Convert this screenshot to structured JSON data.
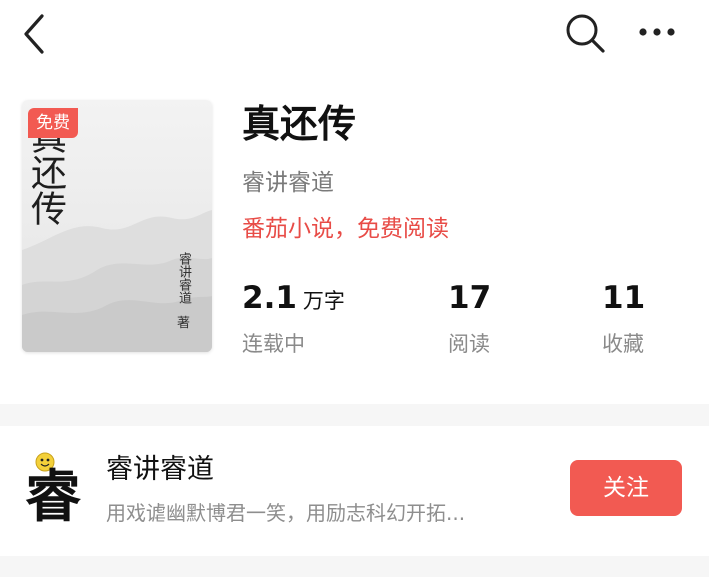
{
  "nav": {
    "back_icon": "chevron-left-icon",
    "search_icon": "search-icon",
    "more_icon": "more-horizontal-icon"
  },
  "book": {
    "cover_title": "真还传",
    "cover_author": "睿讲睿道",
    "cover_author_suffix": "著",
    "free_badge": "免费",
    "title": "真还传",
    "author": "睿讲睿道",
    "promo": "番茄小说，免费阅读"
  },
  "stats": {
    "words": {
      "value": "2.1",
      "unit": "万字",
      "label": "连载中"
    },
    "reads": {
      "value": "17",
      "label": "阅读"
    },
    "favorites": {
      "value": "11",
      "label": "收藏"
    }
  },
  "author_card": {
    "avatar_char": "睿",
    "name": "睿讲睿道",
    "description": "用戏谑幽默博君一笑，用励志科幻开拓...",
    "follow_label": "关注"
  },
  "colors": {
    "accent": "#f25a52",
    "promo_text": "#e84c47",
    "divider": "#f6f6f6"
  }
}
